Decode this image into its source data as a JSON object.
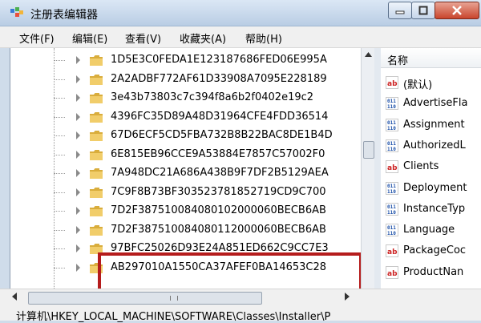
{
  "window": {
    "title": "注册表编辑器"
  },
  "menu": [
    "文件(F)",
    "编辑(E)",
    "查看(V)",
    "收藏夹(A)",
    "帮助(H)"
  ],
  "tree": {
    "keys": [
      "1D5E3C0FEDA1E123187686FED06E995A",
      "2A2ADBF772AF61D33908A7095E228189",
      "3e43b73803c7c394f8a6b2f0402e19c2",
      "4396FC35D89A48D31964CFE4FDD36514",
      "67D6ECF5CD5FBA732B8B22BAC8DE1B4D",
      "6E815EB96CCE9A53884E7857C57002F0",
      "7A948DC21A686A438B9F7DF2B5129AEA",
      "7C9F8B73BF303523781852719CD9C700",
      "7D2F387510084080102000060BECB6AB",
      "7D2F387510084080112000060BECB6AB",
      "97BFC25026D93E24A851ED662C9CC7E3",
      "AB297010A1550CA37AFEF0BA14653C28"
    ],
    "highlighted": [
      8,
      9
    ]
  },
  "values": {
    "header": "名称",
    "items": [
      {
        "name": "(默认)",
        "icon": "ab"
      },
      {
        "name": "AdvertiseFla",
        "icon": "bin"
      },
      {
        "name": "Assignment",
        "icon": "bin"
      },
      {
        "name": "AuthorizedL",
        "icon": "bin"
      },
      {
        "name": "Clients",
        "icon": "ab"
      },
      {
        "name": "Deployment",
        "icon": "bin"
      },
      {
        "name": "InstanceTyp",
        "icon": "bin"
      },
      {
        "name": "Language",
        "icon": "bin"
      },
      {
        "name": "PackageCoc",
        "icon": "ab"
      },
      {
        "name": "ProductNan",
        "icon": "ab"
      }
    ]
  },
  "statusbar": {
    "path": "计算机\\HKEY_LOCAL_MACHINE\\SOFTWARE\\Classes\\Installer\\P"
  },
  "colors": {
    "highlight_border": "#b51c1c",
    "folder": "#e8c15a"
  }
}
